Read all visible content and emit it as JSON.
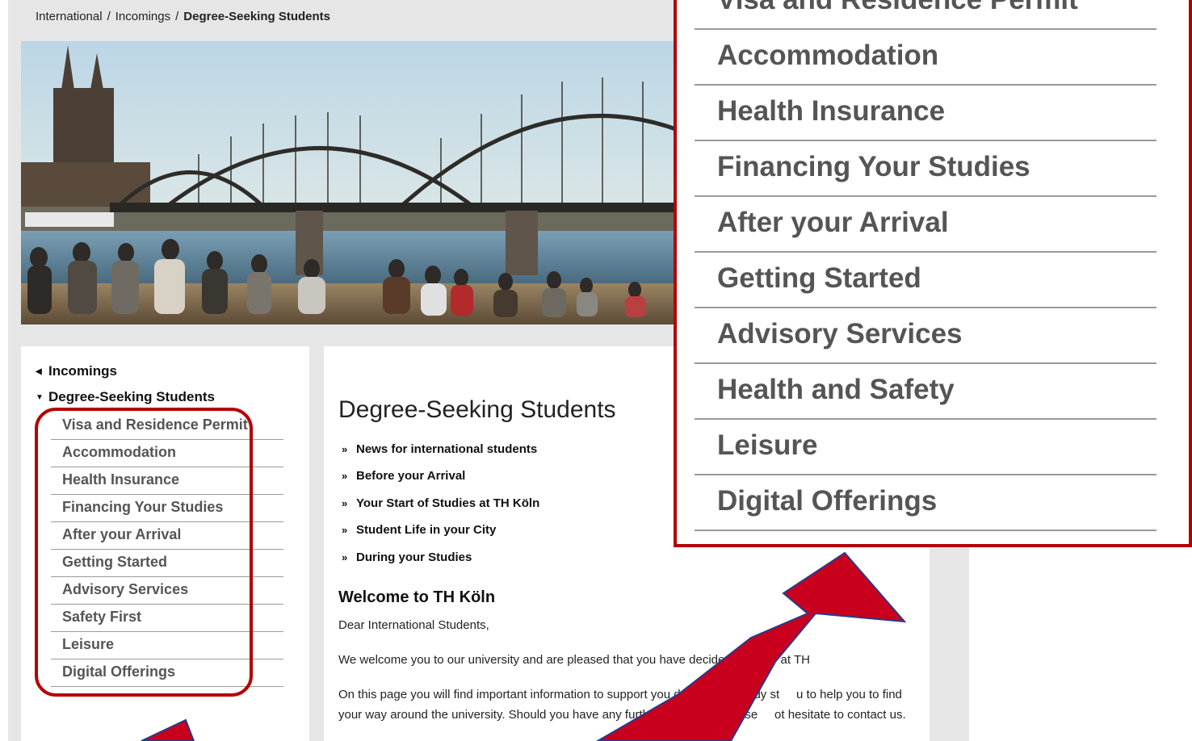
{
  "breadcrumb": {
    "items": [
      "International",
      "Incomings",
      "Degree-Seeking Students"
    ],
    "separator": "/"
  },
  "hero": {
    "alt": "Hohenzollern Bridge and Cologne Cathedral with students sitting by the Rhine"
  },
  "left_nav": {
    "parent": "Incomings",
    "current": "Degree-Seeking Students",
    "items": [
      "Visa and Residence Permit",
      "Accommodation",
      "Health Insurance",
      "Financing Your Studies",
      "After your Arrival",
      "Getting Started",
      "Advisory Services",
      "Safety First",
      "Leisure",
      "Digital Offerings"
    ]
  },
  "content": {
    "title": "Degree-Seeking Students",
    "accordion": [
      "News for international students",
      "Before your Arrival",
      "Your Start of Studies at TH Köln",
      "Student Life in your City",
      "During your Studies"
    ],
    "welcome_heading": "Welcome to TH Köln",
    "greeting": "Dear International Students,",
    "para1": "We welcome you to our university and are pleased that you have decided to study at TH",
    "para2": "On this page you will find important information to support you during your study st     u to help you to find your way around the university. Should you have any further questions, please     ot hesitate to contact us."
  },
  "zoom": {
    "items": [
      "Visa and Residence Permit",
      "Accommodation",
      "Health Insurance",
      "Financing Your Studies",
      "After your Arrival",
      "Getting Started",
      "Advisory Services",
      "Health and Safety",
      "Leisure",
      "Digital Offerings"
    ]
  },
  "colors": {
    "accent_red": "#b30000",
    "arrow_red": "#c8001e",
    "nav_text": "#555555"
  },
  "icons": {
    "collapse_arrow": "triangle-left-icon",
    "expand_arrow": "triangle-down-icon",
    "accordion_chevron": "double-chevron-down-icon"
  }
}
